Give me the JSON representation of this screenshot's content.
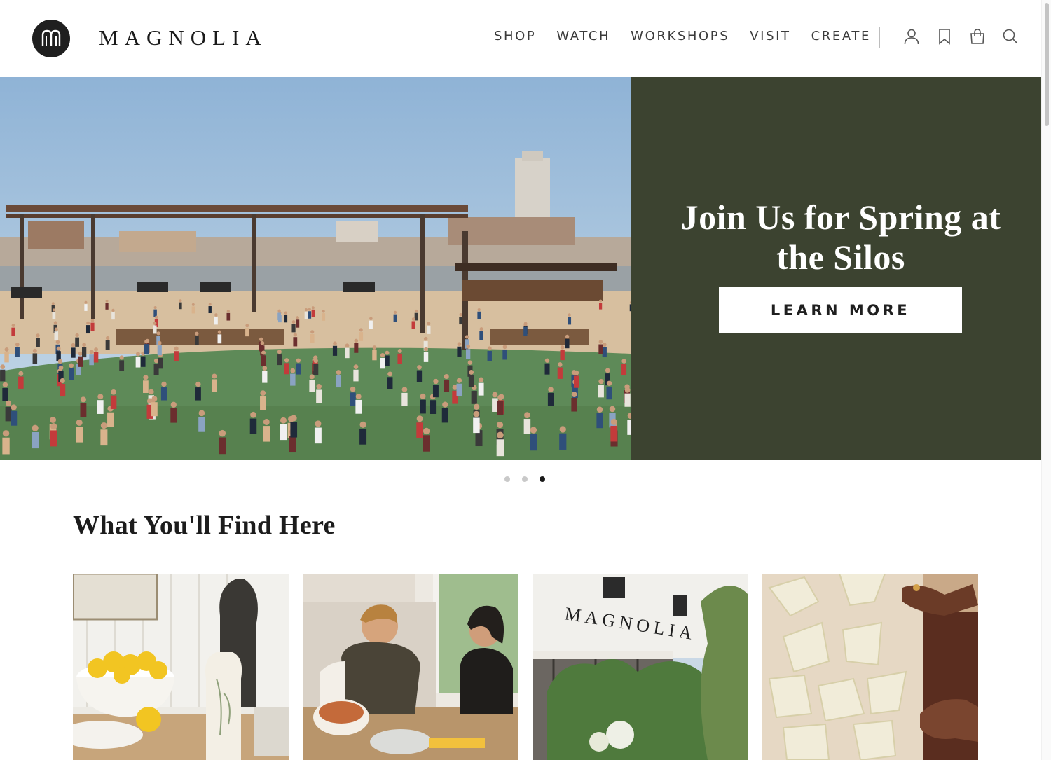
{
  "brand": {
    "name": "MAGNOLIA"
  },
  "nav": {
    "items": [
      {
        "label": "SHOP"
      },
      {
        "label": "WATCH"
      },
      {
        "label": "WORKSHOPS"
      },
      {
        "label": "VISIT"
      },
      {
        "label": "CREATE"
      }
    ],
    "icons": [
      "user-icon",
      "bookmark-icon",
      "shopping-bag-icon",
      "search-icon"
    ]
  },
  "hero": {
    "title": "Join Us for Spring at the Silos",
    "cta_label": "LEARN MORE",
    "panel_color": "#3c4330",
    "slides_total": 3,
    "active_slide": 3
  },
  "section": {
    "title": "What You'll Find Here",
    "cards": [
      {
        "image": "lemons-tableware"
      },
      {
        "image": "couple-cooking"
      },
      {
        "image": "magnolia-storefront"
      },
      {
        "image": "scones-dough"
      }
    ]
  }
}
